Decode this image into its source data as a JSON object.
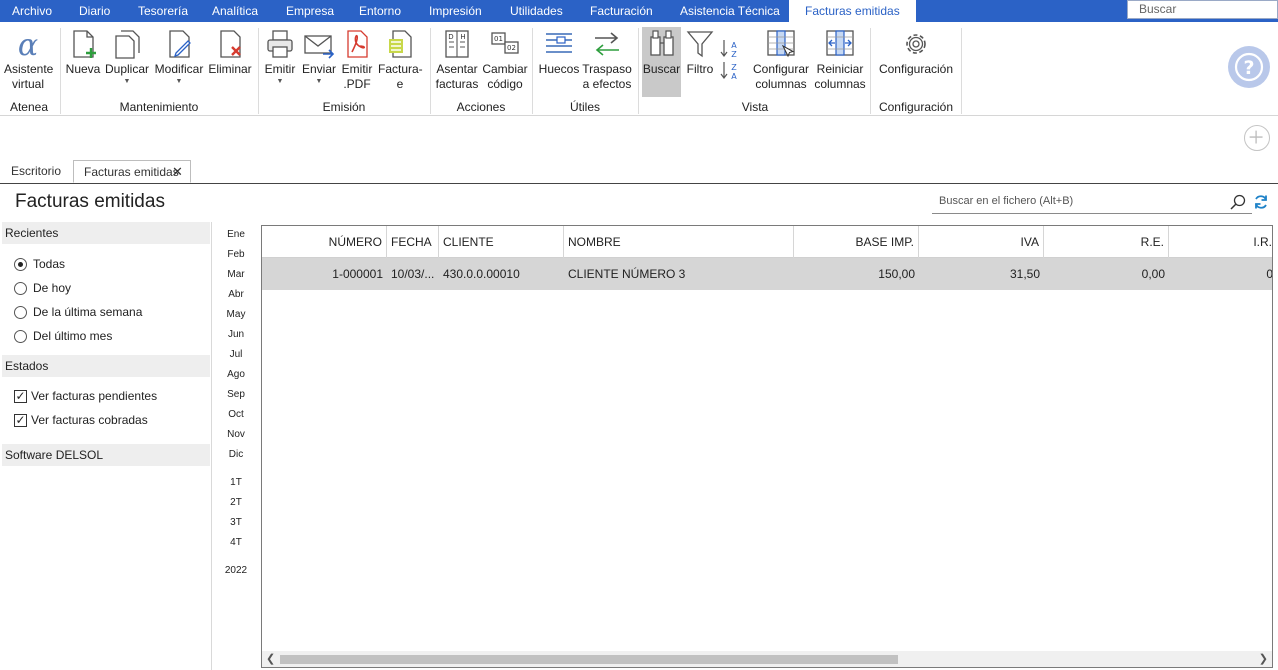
{
  "menu": {
    "tabs": [
      "Archivo",
      "Diario",
      "Tesorería",
      "Analítica",
      "Empresa",
      "Entorno",
      "Impresión",
      "Utilidades",
      "Facturación",
      "Asistencia Técnica"
    ],
    "active_tab": "Facturas emitidas",
    "search_placeholder": "Buscar"
  },
  "ribbon": {
    "buttons": {
      "asistente": "Asistente virtual",
      "nueva": "Nueva",
      "duplicar": "Duplicar",
      "modificar": "Modificar",
      "eliminar": "Eliminar",
      "emitir": "Emitir",
      "enviar": "Enviar",
      "emitir_pdf": "Emitir .PDF",
      "facturae": "Factura-e",
      "asentar": "Asentar facturas",
      "cambiar": "Cambiar código",
      "huecos": "Huecos",
      "traspaso": "Traspaso a efectos",
      "buscar": "Buscar",
      "filtro": "Filtro",
      "config_columnas": "Configurar columnas",
      "reiniciar_columnas": "Reiniciar columnas",
      "configuracion": "Configuración"
    },
    "groups": {
      "atenea": "Atenea",
      "mantenimiento": "Mantenimiento",
      "emision": "Emisión",
      "acciones": "Acciones",
      "utiles": "Útiles",
      "vista": "Vista",
      "configuracion": "Configuración"
    }
  },
  "doc_tabs": {
    "escritorio": "Escritorio",
    "facturas": "Facturas emitidas"
  },
  "page": {
    "title": "Facturas emitidas",
    "search_placeholder": "Buscar en el fichero (Alt+B)"
  },
  "sidebar": {
    "recientes": "Recientes",
    "recent_options": [
      "Todas",
      "De hoy",
      "De la última semana",
      "Del último mes"
    ],
    "selected_recent": "Todas",
    "estados": "Estados",
    "state_options": [
      "Ver facturas pendientes",
      "Ver facturas cobradas"
    ],
    "software": "Software DELSOL"
  },
  "periods": {
    "months": [
      "Ene",
      "Feb",
      "Mar",
      "Abr",
      "May",
      "Jun",
      "Jul",
      "Ago",
      "Sep",
      "Oct",
      "Nov",
      "Dic"
    ],
    "quarters": [
      "1T",
      "2T",
      "3T",
      "4T"
    ],
    "year": "2022"
  },
  "table": {
    "headers": [
      "NÚMERO",
      "FECHA",
      "CLIENTE",
      "NOMBRE",
      "BASE IMP.",
      "IVA",
      "R.E.",
      "I.R."
    ],
    "rows": [
      [
        "1-000001",
        "10/03/...",
        "430.0.0.00010",
        "CLIENTE NÚMERO 3",
        "150,00",
        "31,50",
        "0,00",
        "0"
      ]
    ]
  },
  "colors": {
    "menubar": "#2b62c6",
    "selected_row": "#d6d6d6",
    "help_button": "#b9c8ea"
  }
}
